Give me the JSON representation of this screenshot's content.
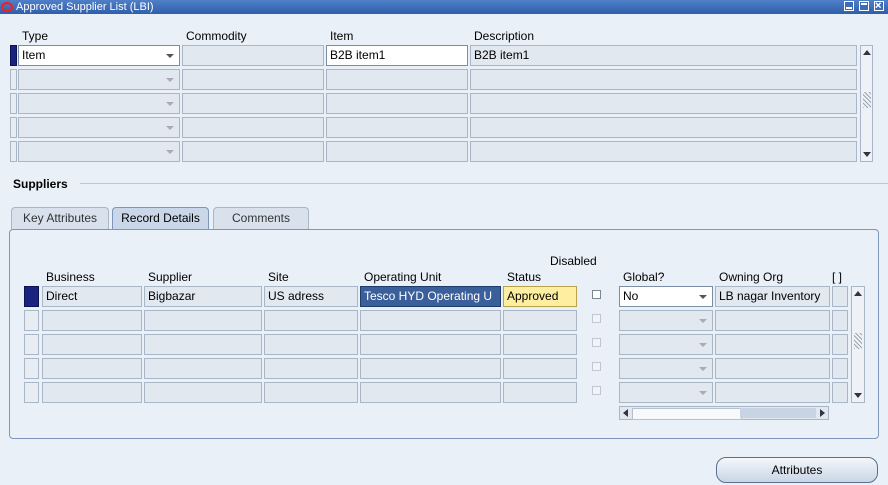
{
  "window": {
    "title": "Approved Supplier List (LBI)",
    "buttons": [
      "minimize-icon",
      "maximize-icon",
      "close-icon"
    ]
  },
  "top_grid": {
    "headers": {
      "type": "Type",
      "commodity": "Commodity",
      "item": "Item",
      "description": "Description"
    },
    "rows": [
      {
        "type": "Item",
        "commodity": "",
        "item": "B2B item1",
        "description": "B2B item1"
      },
      {
        "type": "",
        "commodity": "",
        "item": "",
        "description": ""
      },
      {
        "type": "",
        "commodity": "",
        "item": "",
        "description": ""
      },
      {
        "type": "",
        "commodity": "",
        "item": "",
        "description": ""
      },
      {
        "type": "",
        "commodity": "",
        "item": "",
        "description": ""
      }
    ]
  },
  "suppliers": {
    "section_title": "Suppliers",
    "tabs": [
      "Key Attributes",
      "Record Details",
      "Comments"
    ],
    "active_tab": "Record Details",
    "headers": {
      "business": "Business",
      "supplier": "Supplier",
      "site": "Site",
      "operating_unit": "Operating Unit",
      "status": "Status",
      "disabled": "Disabled",
      "global": "Global?",
      "owning_org": "Owning Org",
      "extra": "[ ]"
    },
    "rows": [
      {
        "business": "Direct",
        "supplier": "Bigbazar",
        "site": "US adress",
        "operating_unit": "Tesco HYD Operating U",
        "status": "Approved",
        "disabled": false,
        "global": "No",
        "owning_org": "LB nagar Inventory"
      },
      {
        "business": "",
        "supplier": "",
        "site": "",
        "operating_unit": "",
        "status": "",
        "disabled": false,
        "global": "",
        "owning_org": ""
      },
      {
        "business": "",
        "supplier": "",
        "site": "",
        "operating_unit": "",
        "status": "",
        "disabled": false,
        "global": "",
        "owning_org": ""
      },
      {
        "business": "",
        "supplier": "",
        "site": "",
        "operating_unit": "",
        "status": "",
        "disabled": false,
        "global": "",
        "owning_org": ""
      },
      {
        "business": "",
        "supplier": "",
        "site": "",
        "operating_unit": "",
        "status": "",
        "disabled": false,
        "global": "",
        "owning_org": ""
      }
    ]
  },
  "attributes_button": "Attributes",
  "colors": {
    "title_bar": "#2f5fab",
    "selected_cell": "#3a5f9b",
    "status_highlight": "#fdeea0",
    "record_marker": "#1a237e"
  }
}
